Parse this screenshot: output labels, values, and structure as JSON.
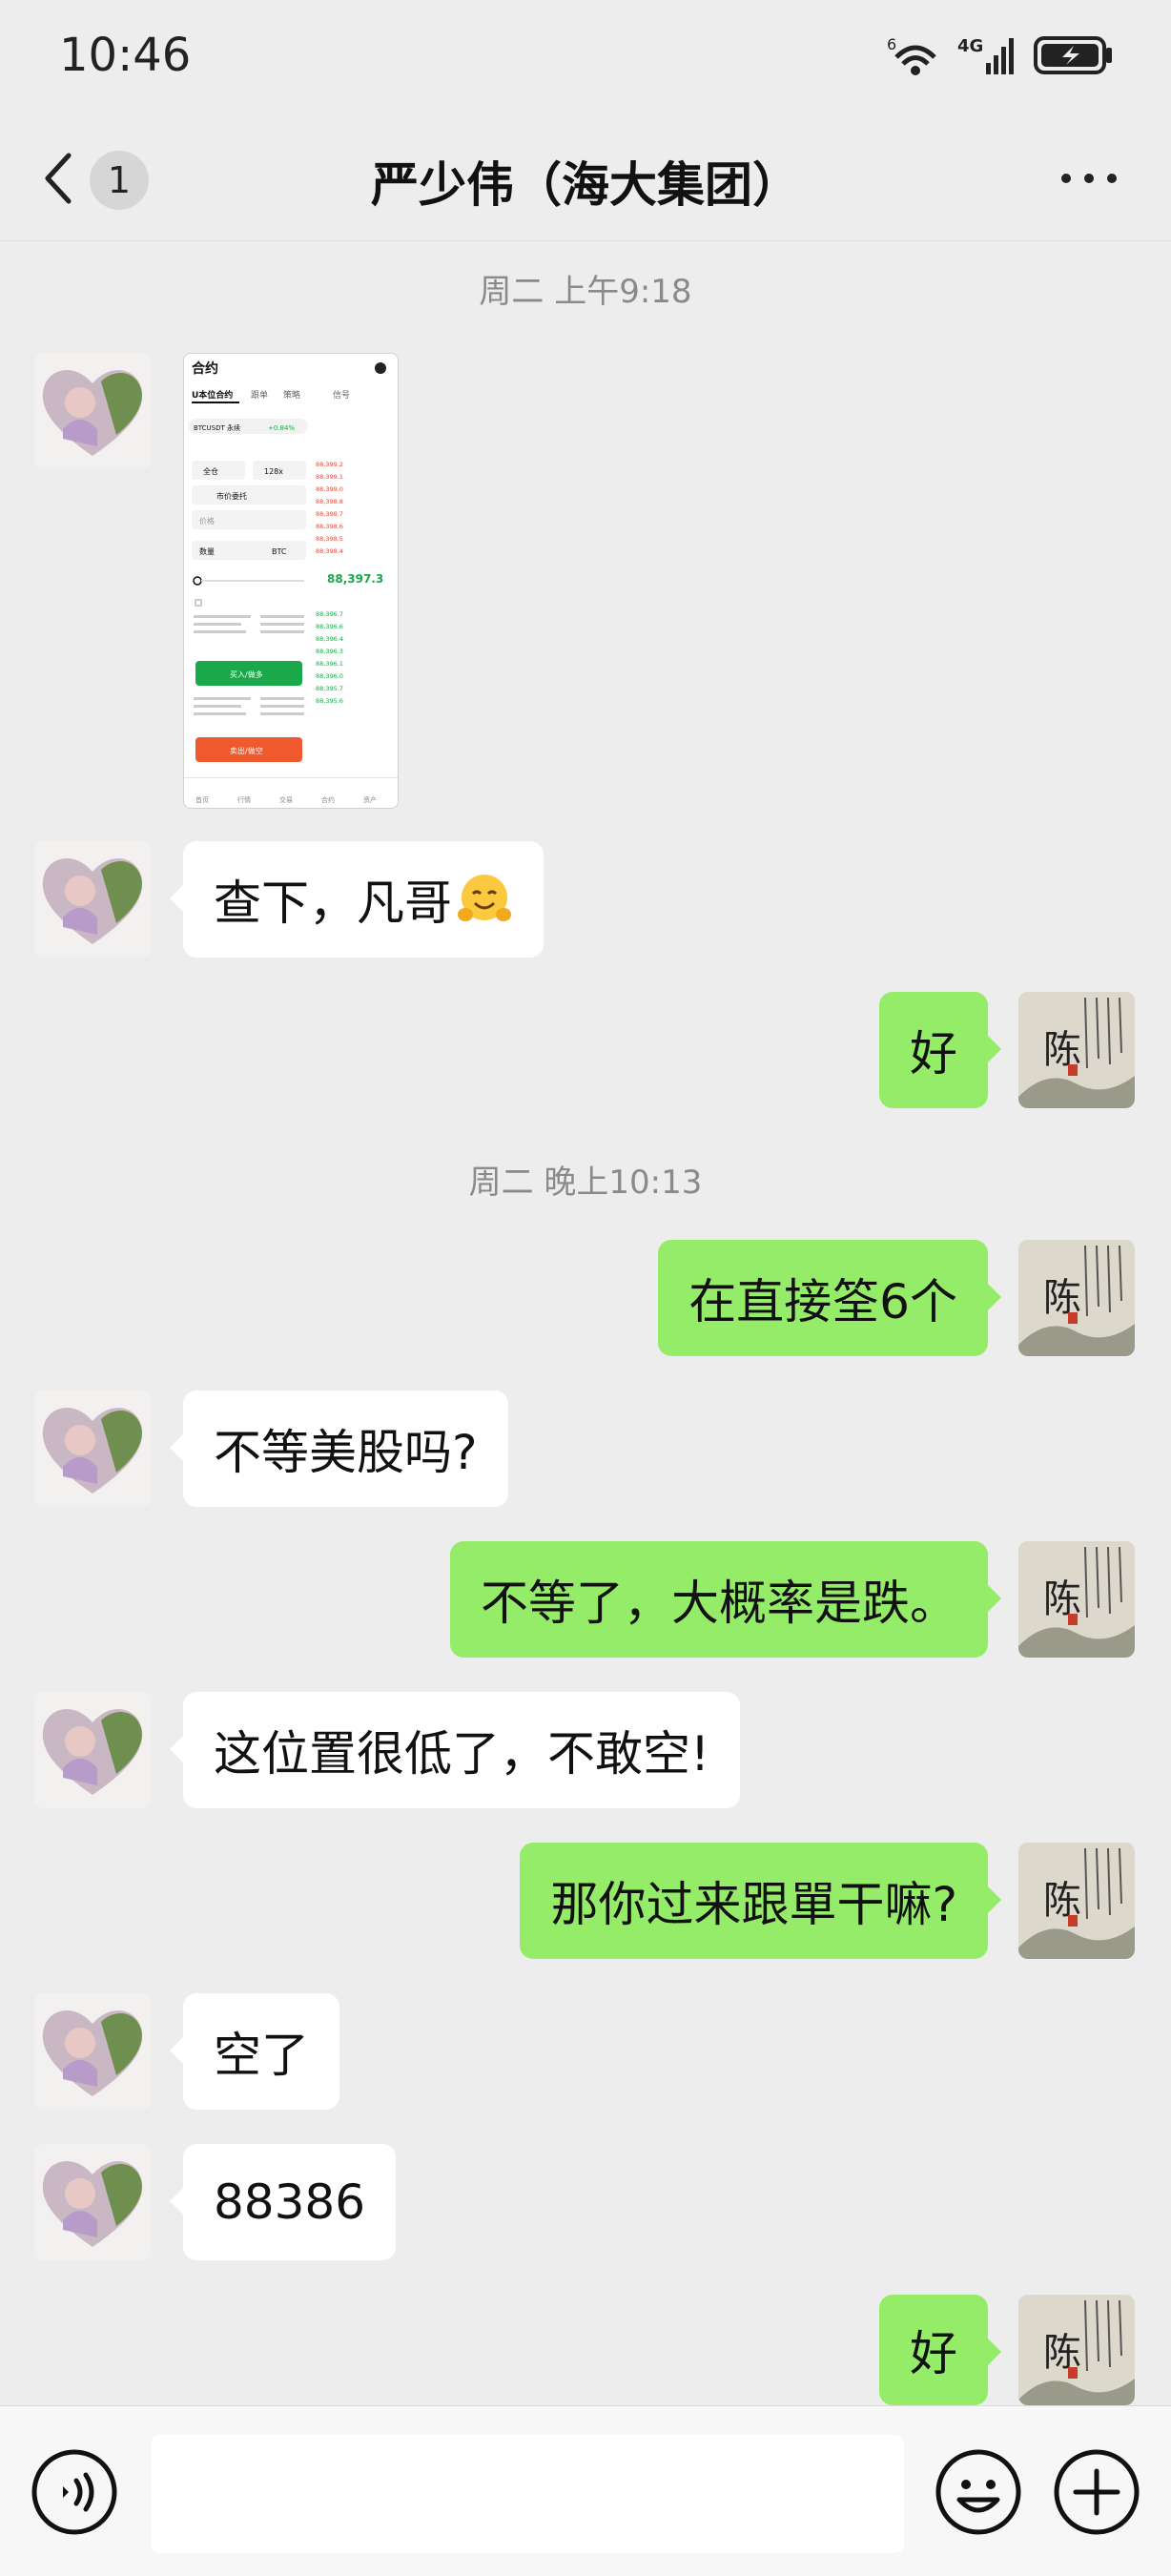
{
  "status_bar": {
    "time": "10:46",
    "wifi_label": "6",
    "network_label": "4G"
  },
  "header": {
    "unread_count": "1",
    "title": "严少伟（海大集团）"
  },
  "avatar_text": {
    "contact_name": "陈"
  },
  "timestamps": {
    "first": "周二 上午9:18",
    "second": "周二 晚上10:13"
  },
  "messages": [
    {
      "side": "left",
      "text": "查下，凡哥"
    },
    {
      "side": "right",
      "text": "好"
    },
    {
      "side": "right",
      "text": "在直接筌6个"
    },
    {
      "side": "left",
      "text": "不等美股吗?"
    },
    {
      "side": "right",
      "text": "不等了，大概率是跌。"
    },
    {
      "side": "left",
      "text": "这位置很低了，不敢空!"
    },
    {
      "side": "right",
      "text": "那你过来跟單干嘛?"
    },
    {
      "side": "left",
      "text": "空了"
    },
    {
      "side": "left",
      "text": "88386"
    },
    {
      "side": "right",
      "text": "好"
    }
  ],
  "screenshot_thumb": {
    "title": "合约",
    "tabs": [
      "U本位合约",
      "跟单",
      "策略",
      "信号"
    ],
    "pair": "BTCUSDT 永续",
    "change": "+0.84%",
    "mode": "全仓",
    "leverage": "128x",
    "order_type": "市价委托",
    "price_placeholder": "价格",
    "qty_label": "数量",
    "qty_unit": "BTC",
    "buy_label": "买入/做多",
    "sell_label": "卖出/做空",
    "last_price": "88,397.3",
    "asks": [
      "88,399.2",
      "88,399.1",
      "88,399.0",
      "88,398.8",
      "88,398.7",
      "88,398.6",
      "88,398.5",
      "88,398.4"
    ],
    "bids": [
      "88,396.7",
      "88,396.6",
      "88,396.4",
      "88,396.3",
      "88,396.1",
      "88,396.0",
      "88,395.7",
      "88,395.6"
    ],
    "nav": [
      "首页",
      "行情",
      "交易",
      "合约",
      "资产"
    ]
  }
}
